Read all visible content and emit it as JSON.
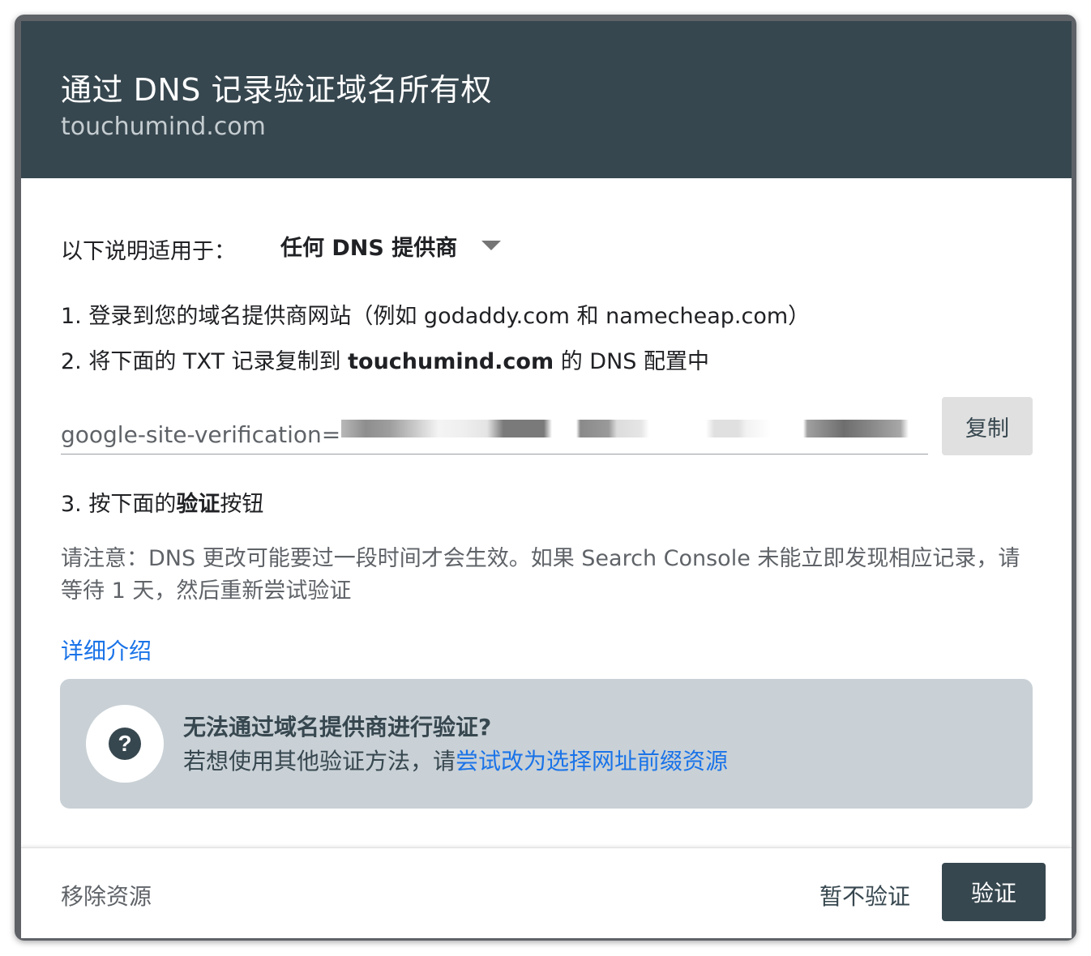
{
  "dialog": {
    "title": "通过 DNS 记录验证域名所有权",
    "subtitle": "touchumind.com"
  },
  "instructions": {
    "applies_label": "以下说明适用于：",
    "provider_value": "任何 DNS 提供商",
    "step1": "1. 登录到您的域名提供商网站（例如 godaddy.com 和 namecheap.com）",
    "step2_prefix": "2. 将下面的 TXT 记录复制到 ",
    "step2_domain": "touchumind.com",
    "step2_suffix": " 的 DNS 配置中",
    "step3_prefix": "3. 按下面的",
    "step3_bold": "验证",
    "step3_suffix": "按钮"
  },
  "record": {
    "prefix": "google-site-verification=",
    "copy_label": "复制"
  },
  "note": "请注意：DNS 更改可能要过一段时间才会生效。如果 Search Console 未能立即发现相应记录，请等待 1 天，然后重新尝试验证",
  "learn_more": "详细介绍",
  "help_box": {
    "icon": "question-icon",
    "icon_glyph": "?",
    "title": "无法通过域名提供商进行验证?",
    "body_prefix": "若想使用其他验证方法，请",
    "body_link": "尝试改为选择网址前缀资源"
  },
  "footer": {
    "remove_label": "移除资源",
    "later_label": "暂不验证",
    "verify_label": "验证"
  },
  "colors": {
    "header_bg": "#37474f",
    "link": "#1a73e8",
    "help_bg": "#c9d1d6",
    "verify_bg": "#37474f"
  }
}
